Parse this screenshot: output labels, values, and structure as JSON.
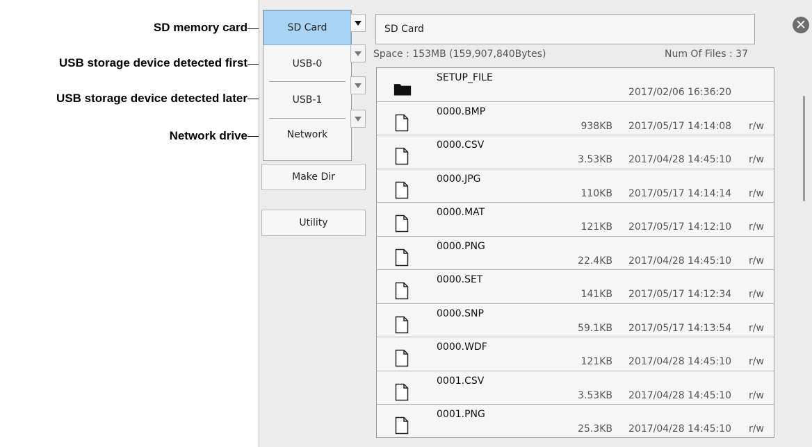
{
  "callouts": [
    {
      "label": "SD memory card"
    },
    {
      "label": "USB storage device detected first"
    },
    {
      "label": "USB storage device detected later"
    },
    {
      "label": "Network drive"
    }
  ],
  "drives": [
    {
      "label": "SD Card",
      "selected": true
    },
    {
      "label": "USB-0",
      "selected": false
    },
    {
      "label": "USB-1",
      "selected": false
    },
    {
      "label": "Network",
      "selected": false
    }
  ],
  "buttons": {
    "make_dir": "Make Dir",
    "utility": "Utility"
  },
  "path": "SD Card",
  "space": "Space : 153MB (159,907,840Bytes)",
  "num_files": "Num Of Files : 37",
  "icons": {
    "folder": "folder-icon",
    "file": "file-icon",
    "close": "close-icon",
    "close_glyph": "✕"
  },
  "files": [
    {
      "type": "folder",
      "name": "SETUP_FILE",
      "size": "",
      "date": "2017/02/06 16:36:20",
      "attr": ""
    },
    {
      "type": "file",
      "name": "0000.BMP",
      "size": "938KB",
      "date": "2017/05/17 14:14:08",
      "attr": "r/w"
    },
    {
      "type": "file",
      "name": "0000.CSV",
      "size": "3.53KB",
      "date": "2017/04/28 14:45:10",
      "attr": "r/w"
    },
    {
      "type": "file",
      "name": "0000.JPG",
      "size": "110KB",
      "date": "2017/05/17 14:14:14",
      "attr": "r/w"
    },
    {
      "type": "file",
      "name": "0000.MAT",
      "size": "121KB",
      "date": "2017/05/17 14:12:10",
      "attr": "r/w"
    },
    {
      "type": "file",
      "name": "0000.PNG",
      "size": "22.4KB",
      "date": "2017/04/28 14:45:10",
      "attr": "r/w"
    },
    {
      "type": "file",
      "name": "0000.SET",
      "size": "141KB",
      "date": "2017/05/17 14:12:34",
      "attr": "r/w"
    },
    {
      "type": "file",
      "name": "0000.SNP",
      "size": "59.1KB",
      "date": "2017/05/17 14:13:54",
      "attr": "r/w"
    },
    {
      "type": "file",
      "name": "0000.WDF",
      "size": "121KB",
      "date": "2017/04/28 14:45:10",
      "attr": "r/w"
    },
    {
      "type": "file",
      "name": "0001.CSV",
      "size": "3.53KB",
      "date": "2017/04/28 14:45:10",
      "attr": "r/w"
    },
    {
      "type": "file",
      "name": "0001.PNG",
      "size": "25.3KB",
      "date": "2017/04/28 14:45:10",
      "attr": "r/w"
    }
  ]
}
